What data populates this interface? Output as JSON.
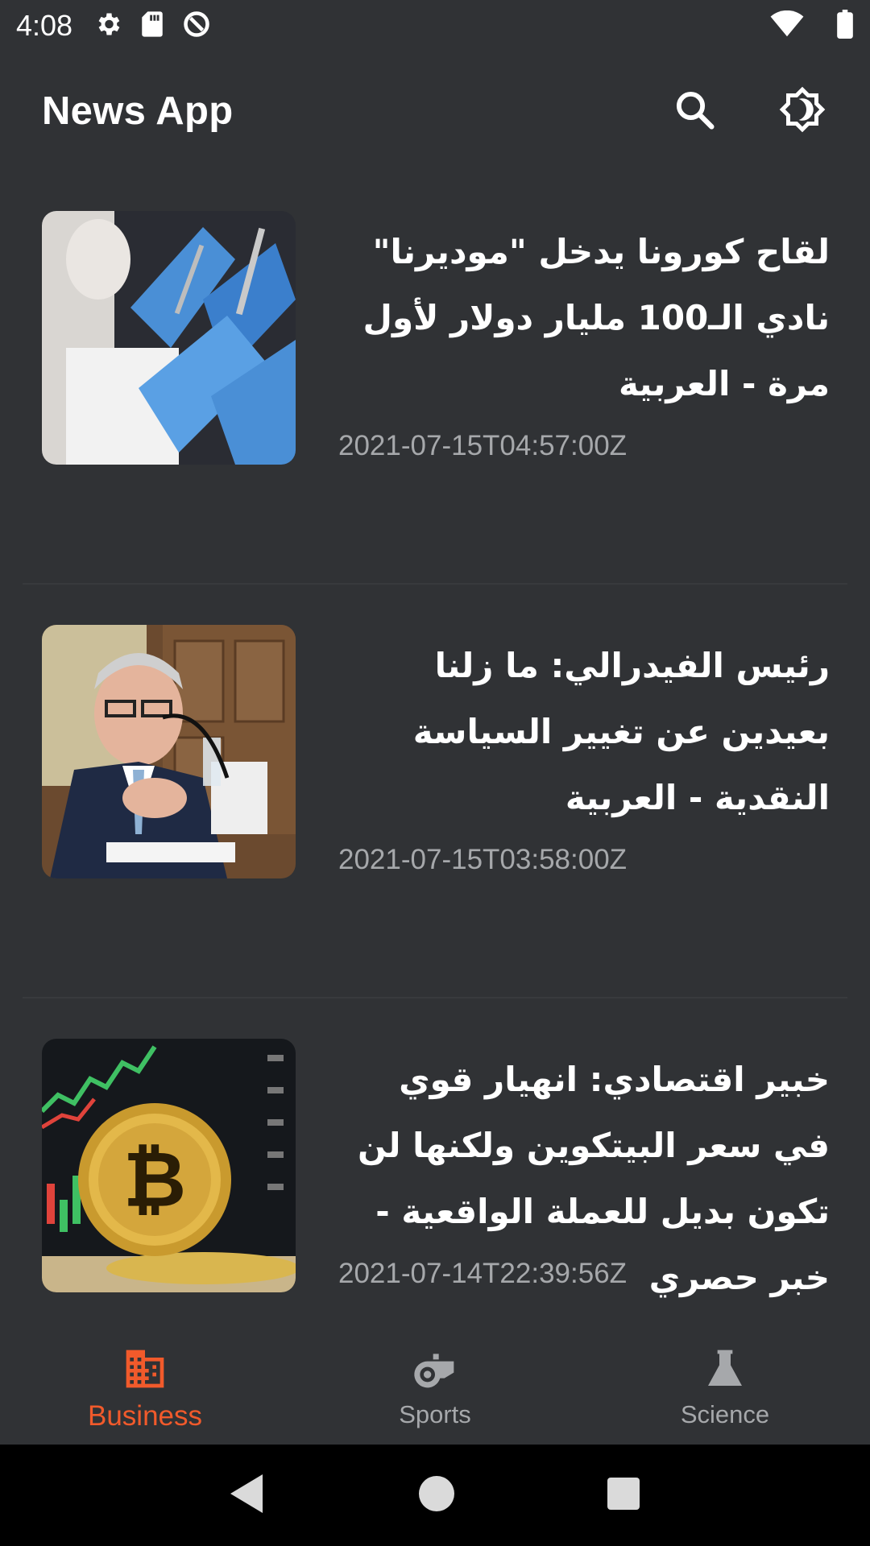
{
  "status_bar": {
    "time": "4:08",
    "icons": [
      "gear-icon",
      "sd-card-icon",
      "data-saver-icon"
    ],
    "right_icons": [
      "wifi-icon",
      "battery-icon"
    ]
  },
  "app_bar": {
    "title": "News App",
    "actions": [
      "search-icon",
      "brightness-icon"
    ]
  },
  "articles": [
    {
      "headline": "لقاح كورونا يدخل \"موديرنا\" نادي الـ100 مليار دولار لأول مرة - العربية",
      "published_at": "2021-07-15T04:57:00Z"
    },
    {
      "headline": "رئيس الفيدرالي: ما زلنا بعيدين عن تغيير السياسة النقدية - العربية",
      "published_at": "2021-07-15T03:58:00Z"
    },
    {
      "headline": "خبير اقتصادي: انهيار قوي في سعر البيتكوين ولكنها لن تكون بديل للعملة الواقعية - خبر حصري",
      "published_at": "2021-07-14T22:39:56Z"
    }
  ],
  "bottom_nav": {
    "items": [
      {
        "label": "Business",
        "icon": "building-icon",
        "active": true
      },
      {
        "label": "Sports",
        "icon": "whistle-icon",
        "active": false
      },
      {
        "label": "Science",
        "icon": "flask-icon",
        "active": false
      }
    ]
  },
  "colors": {
    "background": "#303235",
    "accent": "#f15a2b",
    "secondary_text": "#a6a8ab"
  },
  "system_nav": [
    "back-icon",
    "home-icon",
    "recents-icon"
  ]
}
